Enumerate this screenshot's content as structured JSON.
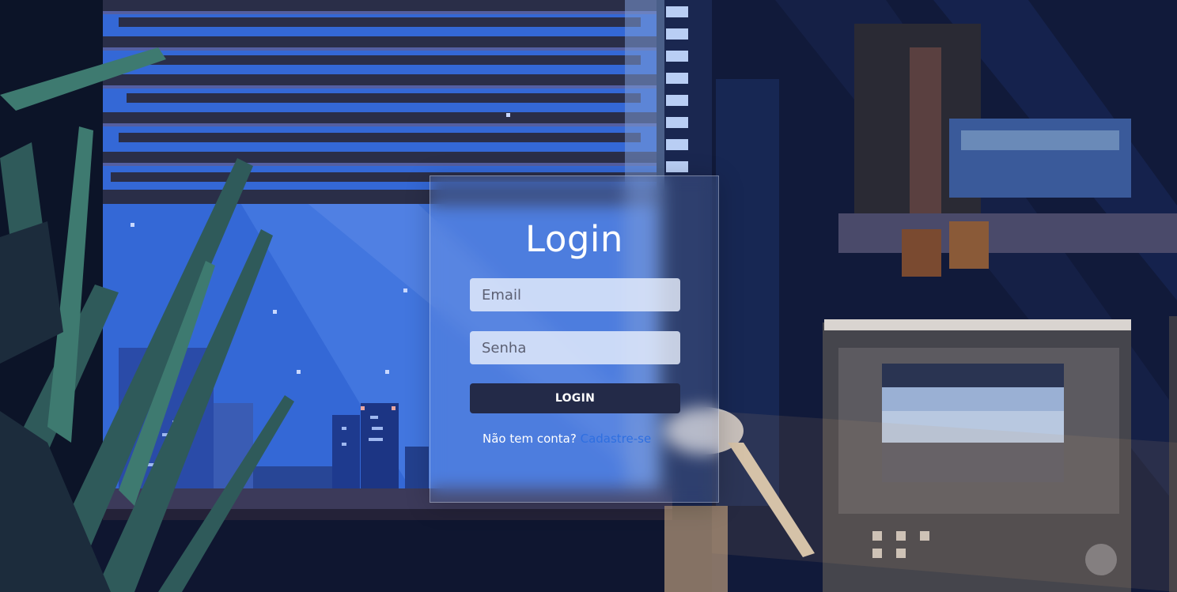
{
  "login": {
    "title": "Login",
    "email_placeholder": "Email",
    "password_placeholder": "Senha",
    "button_label": "LOGIN",
    "signup_prompt": "Não tem conta?",
    "signup_link": "Cadastre-se"
  },
  "colors": {
    "button_bg": "#232a48",
    "link": "#2f6fe0",
    "input_bg": "#e8eefc",
    "background_primary": "#0d1530",
    "window_sky": "#3a6fd8"
  },
  "background": {
    "description_icon": "pixel-art-room-background"
  }
}
